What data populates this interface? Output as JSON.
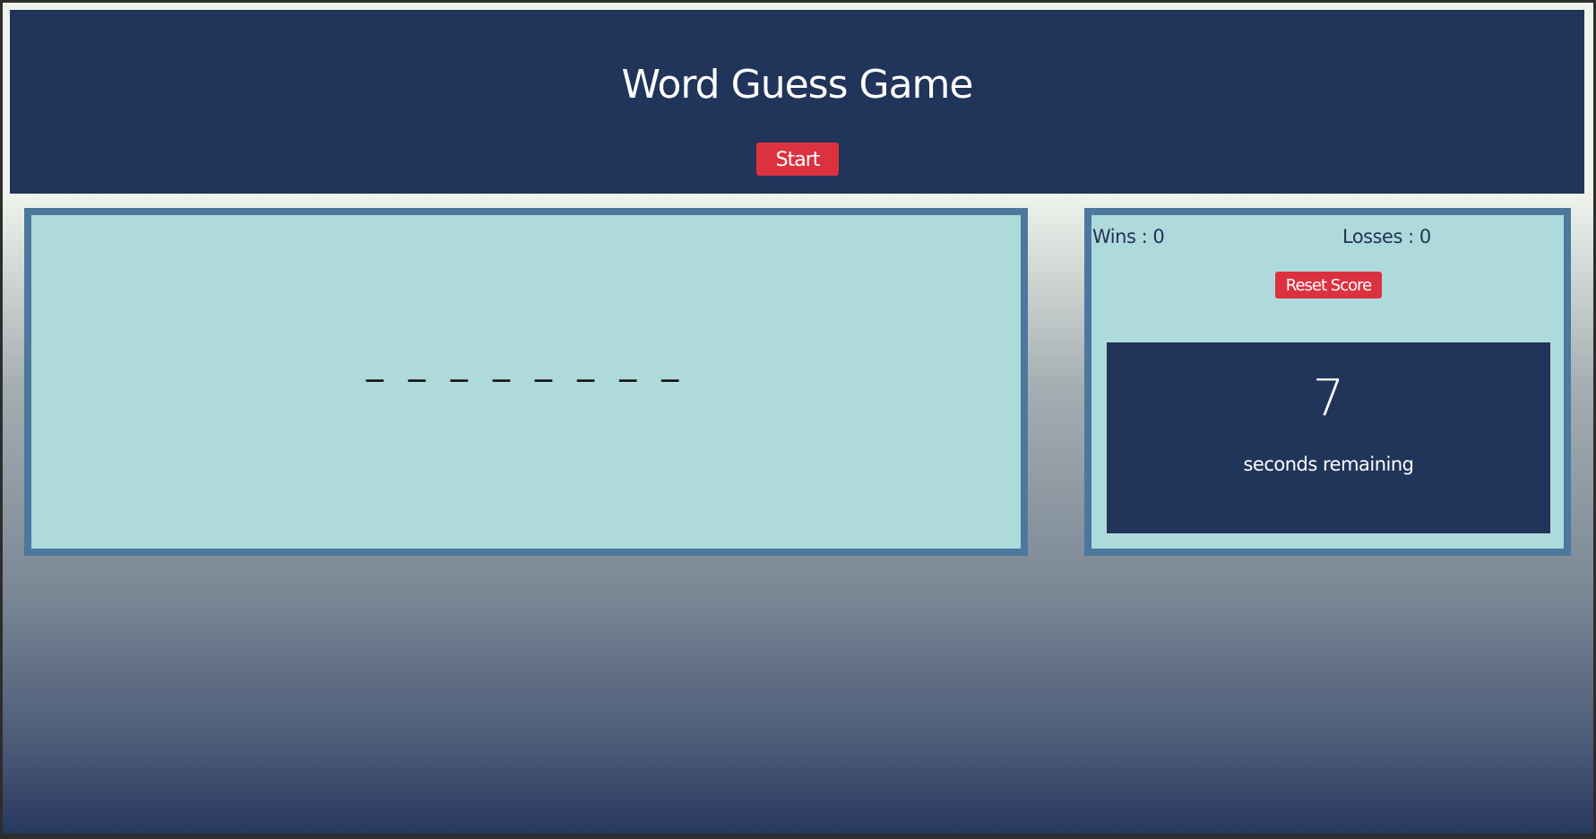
{
  "header": {
    "title": "Word Guess Game",
    "start_label": "Start"
  },
  "game": {
    "word_display": "_ _ _ _ _ _ _ _"
  },
  "score": {
    "wins_text": "Wins : 0",
    "losses_text": "Losses : 0",
    "reset_label": "Reset Score"
  },
  "timer": {
    "value": "7",
    "label": "seconds remaining"
  },
  "colors": {
    "header_bg": "#213459",
    "button_red": "#dc3240",
    "panel_bg": "#afdadc",
    "panel_border": "#4c789e"
  }
}
